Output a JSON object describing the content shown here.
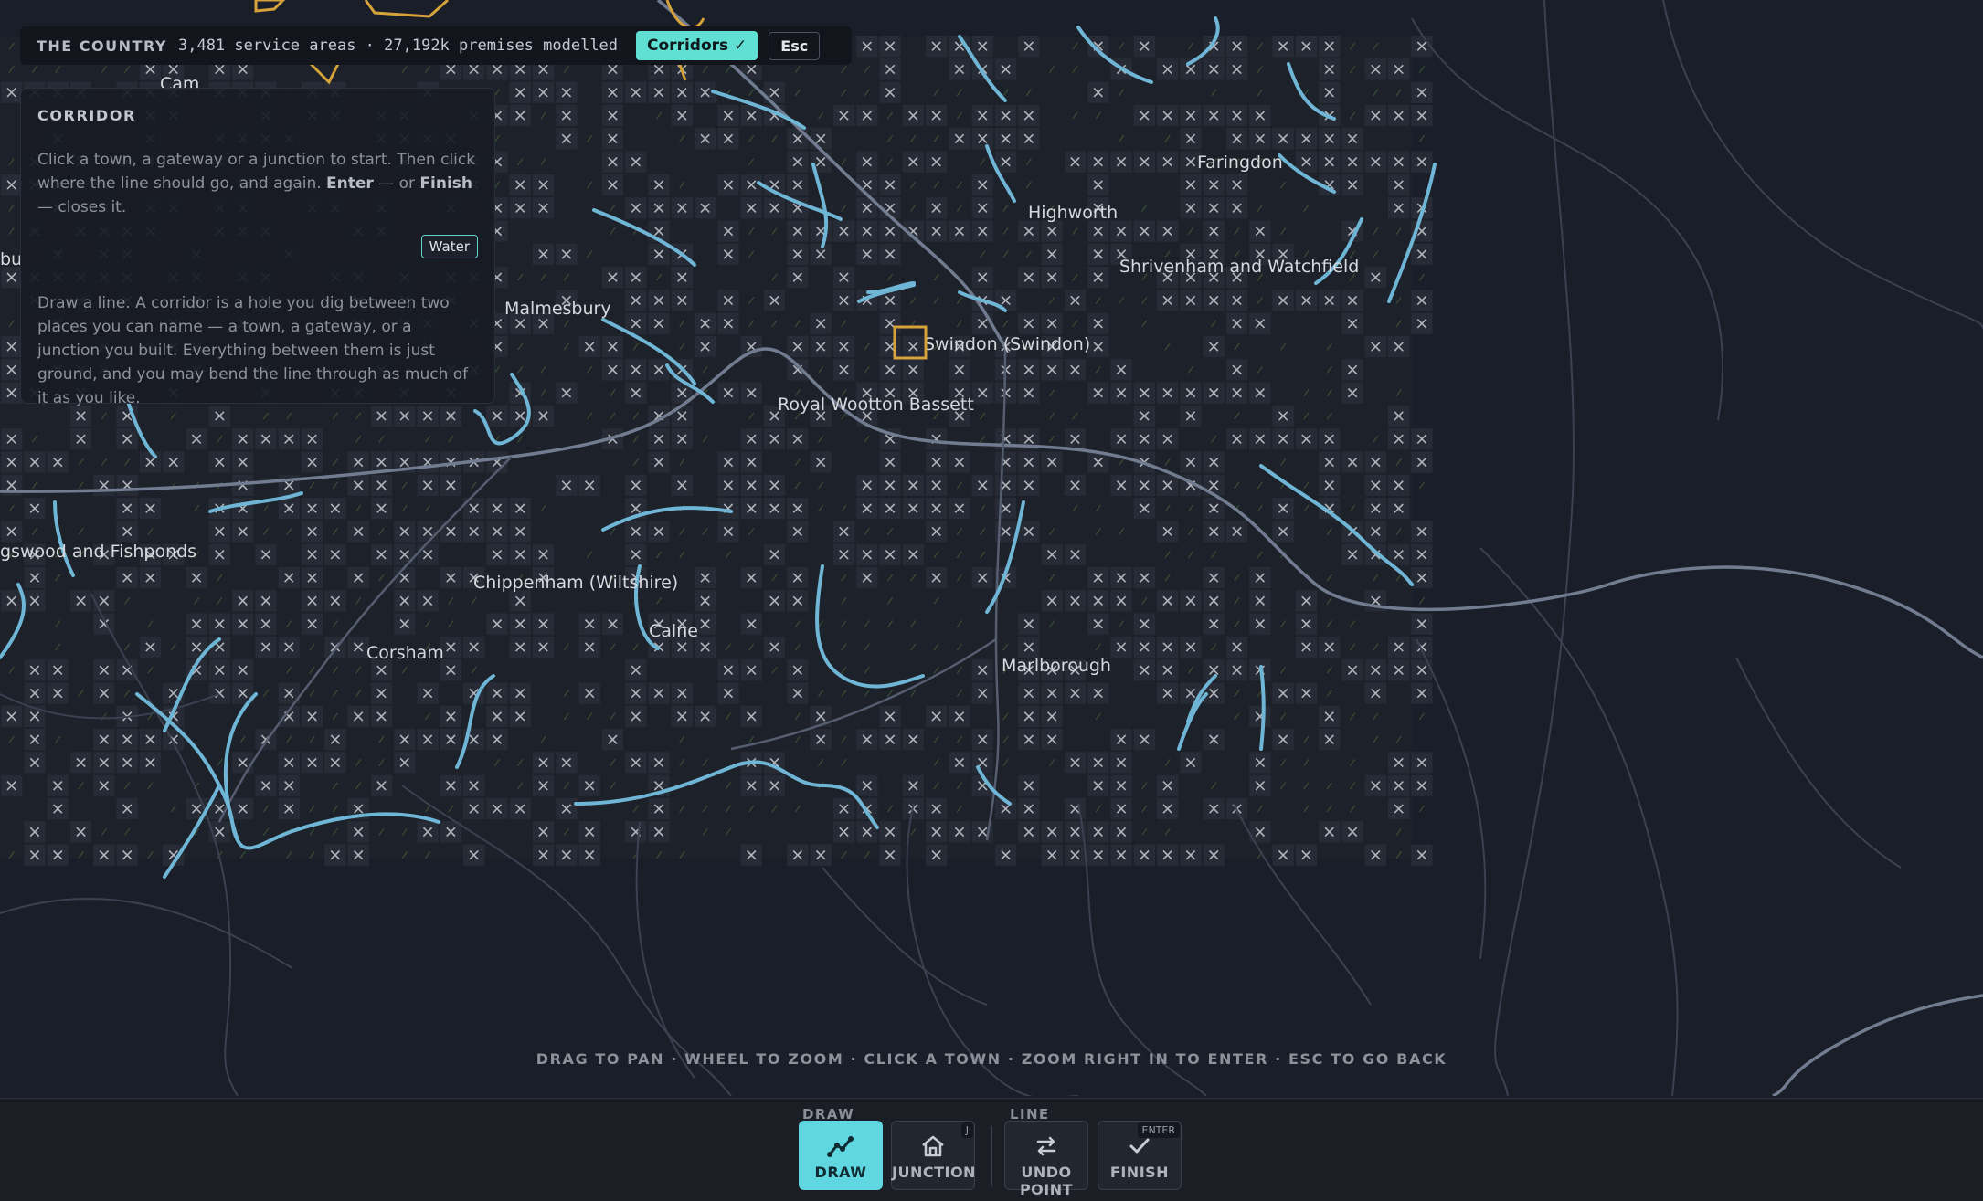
{
  "header": {
    "region": "THE COUNTRY",
    "stats": "3,481 service areas · 27,192k premises modelled",
    "corridors_button": "Corridors ✓",
    "esc_button": "Esc"
  },
  "panel": {
    "title": "CORRIDOR",
    "instr_start": "Click a town, a gateway or a junction to start. Then click where the line should go, and again. ",
    "instr_enter": "Enter",
    "instr_or": " — or ",
    "instr_finish": "Finish",
    "instr_end": " — closes it.",
    "water_button": "Water",
    "description": "Draw a line. A corridor is a hole you dig between two places you can name — a town, a gateway, or a junction you built. Everything between them is just ground, and you may bend the line through as much of it as you like."
  },
  "map": {
    "towns": [
      "Cam",
      "Faringdon",
      "Highworth",
      "Shrivenham and Watchfield",
      "Malmesbury",
      "Swindon (Swindon)",
      "Royal Wootton Bassett",
      "gswood and Fishponds",
      "Chippenham (Wiltshire)",
      "Calne",
      "Corsham",
      "Marlborough",
      "bu"
    ],
    "colors": {
      "background": "#1a1e28",
      "roads": "#6d7689",
      "rivers": "#6fb6d6",
      "grid_x": "#c9ccd2",
      "selected": "#d6a23a",
      "accent": "#5fe0d3"
    }
  },
  "hint": "DRAG TO PAN · WHEEL TO ZOOM · CLICK A TOWN · ZOOM RIGHT IN TO ENTER · ESC TO GO BACK",
  "toolbar": {
    "draw_group": "DRAW",
    "line_group": "LINE",
    "tools": [
      {
        "label": "DRAW",
        "key": "",
        "icon": "draw-line-icon"
      },
      {
        "label": "JUNCTION",
        "key": "J",
        "icon": "junction-icon"
      },
      {
        "label": "UNDO POINT",
        "key": "",
        "icon": "undo-arrows-icon"
      },
      {
        "label": "FINISH",
        "key": "ENTER",
        "icon": "check-icon"
      }
    ]
  }
}
